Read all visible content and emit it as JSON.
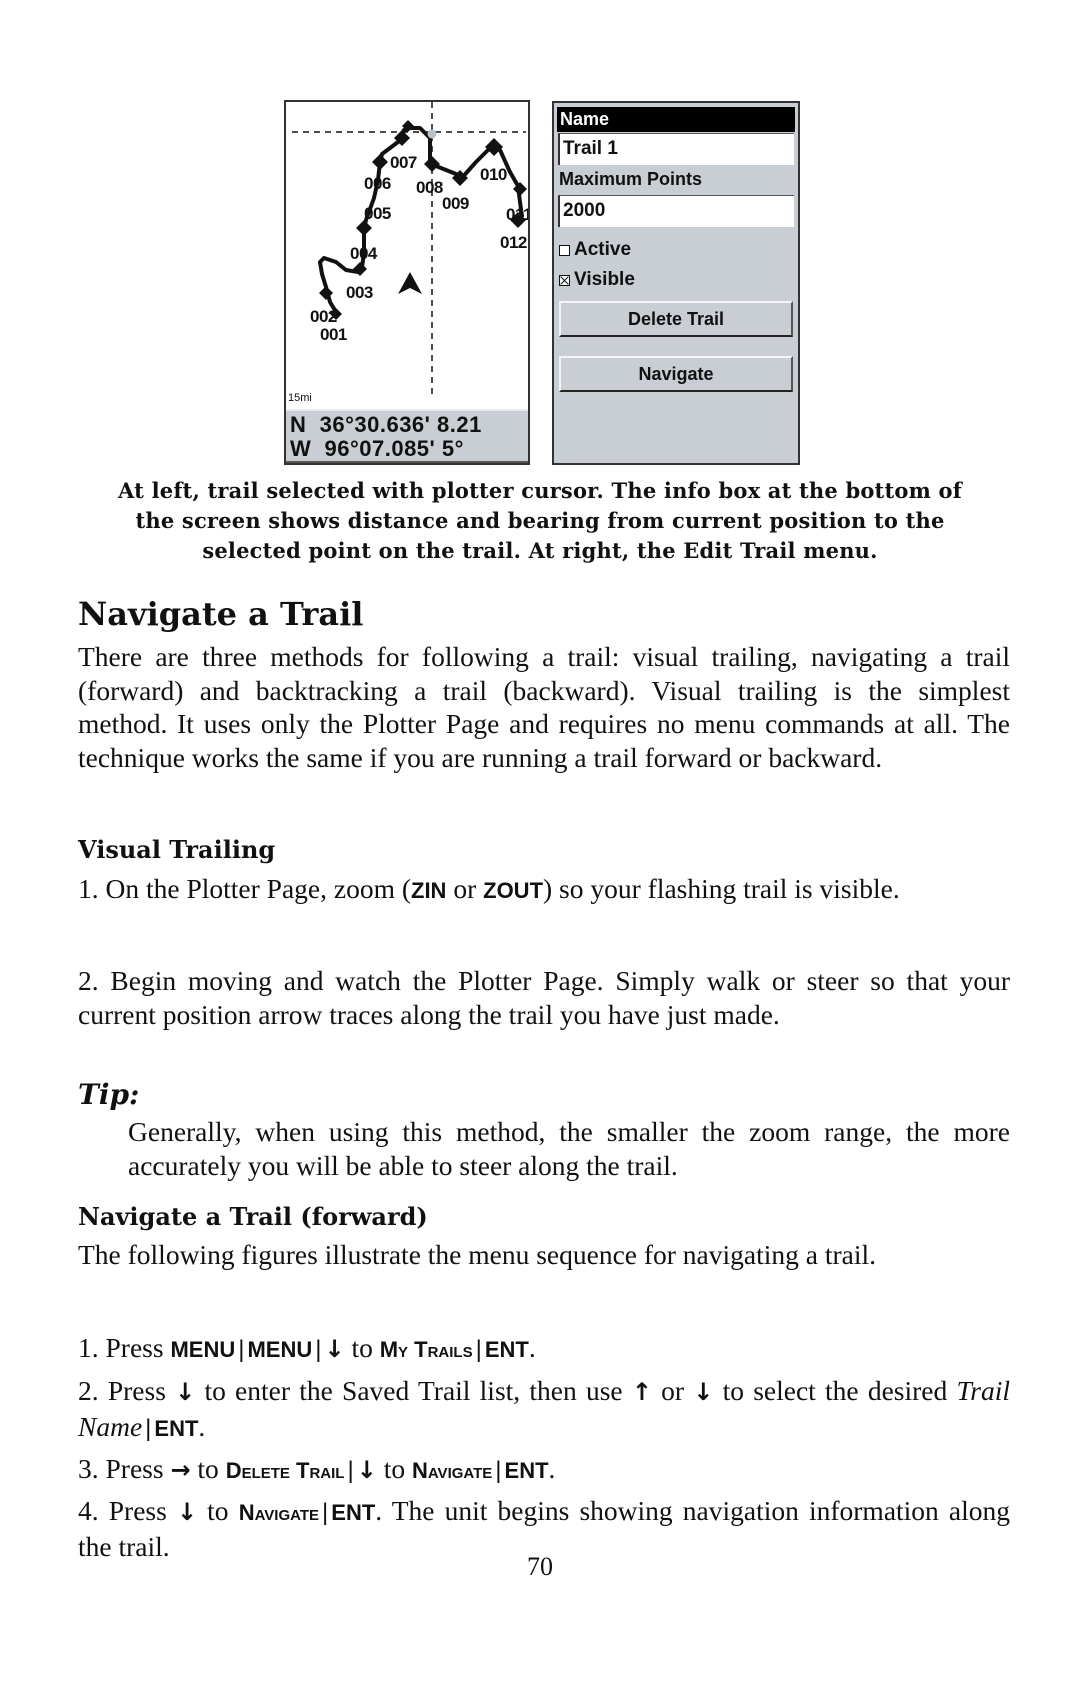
{
  "plotter": {
    "scale": "15mi",
    "info_line1": "N  36°30.636' 8.21",
    "info_line2": "W  96°07.085' 5°",
    "waypoints": [
      "001",
      "002",
      "003",
      "004",
      "005",
      "006",
      "007",
      "008",
      "009",
      "010",
      "011",
      "012"
    ]
  },
  "edit_menu": {
    "title": "Name",
    "name_value": "Trail 1",
    "max_points_label": "Maximum Points",
    "max_points_value": "2000",
    "active_label": "Active",
    "active_checked": false,
    "visible_label": "Visible",
    "visible_checked": true,
    "delete_button": "Delete Trail",
    "navigate_button": "Navigate"
  },
  "caption": {
    "line1": "At left, trail selected with plotter cursor. The info box at the bottom of",
    "line2": "the screen shows distance and bearing from current position to the",
    "line3": "selected point on the trail. At right, the Edit Trail menu."
  },
  "section": {
    "title": "Navigate a Trail",
    "intro": "There are three methods for following a trail: visual trailing, navigating a trail (forward) and backtracking a trail (backward). Visual trailing is the simplest method. It uses only the Plotter Page and requires no menu commands at all. The technique works the same if you are running a trail forward or backward."
  },
  "visual_trailing": {
    "heading": "Visual Trailing",
    "step1_a": "1. On the Plotter Page, zoom (",
    "step1_key1": "ZIN",
    "step1_or": " or ",
    "step1_key2": "ZOUT",
    "step1_b": ") so your flashing trail is visible.",
    "step2": "2. Begin moving and watch the Plotter Page. Simply walk or steer so that your current position arrow traces along the trail you have just made."
  },
  "tip": {
    "label": "Tip:",
    "text": "Generally, when using this method, the smaller the zoom range, the more accurately you will be able to steer along the trail."
  },
  "navigate_forward": {
    "heading": "Navigate a Trail (forward)",
    "intro": "The following figures illustrate the menu sequence for navigating a trail.",
    "step1": {
      "prefix": "1. Press ",
      "key_menu": "MENU",
      "key_menu2": "MENU",
      "arrow_down": "↓",
      "to": " to ",
      "key_mytrails": "My Trails",
      "key_ent": "ENT",
      "end": "."
    },
    "step2": {
      "prefix": "2. Press ",
      "arrow_down": "↓",
      "mid1": " to enter the Saved Trail list, then use ",
      "arrow_up": "↑",
      "or": " or ",
      "arrow_down2": "↓",
      "mid2": " to select the desired ",
      "trail_name": "Trail Name",
      "key_ent": "ENT",
      "end": "."
    },
    "step3": {
      "prefix": "3. Press ",
      "arrow_right": "→",
      "to1": " to ",
      "key_delete": "Delete Trail",
      "arrow_down": "↓",
      "to2": " to ",
      "key_navigate": "Navigate",
      "key_ent": "ENT",
      "end": "."
    },
    "step4": {
      "prefix": "4. Press ",
      "arrow_down": "↓",
      "to": " to ",
      "key_navigate": "Navigate",
      "key_ent": "ENT",
      "rest": ". The unit begins showing navigation information along the trail."
    }
  },
  "footer": {
    "page_number": "70"
  },
  "colors": {
    "screen_gray": "#c9ced4",
    "ink": "#111111",
    "cursor_dot": "#b8c0c8"
  }
}
